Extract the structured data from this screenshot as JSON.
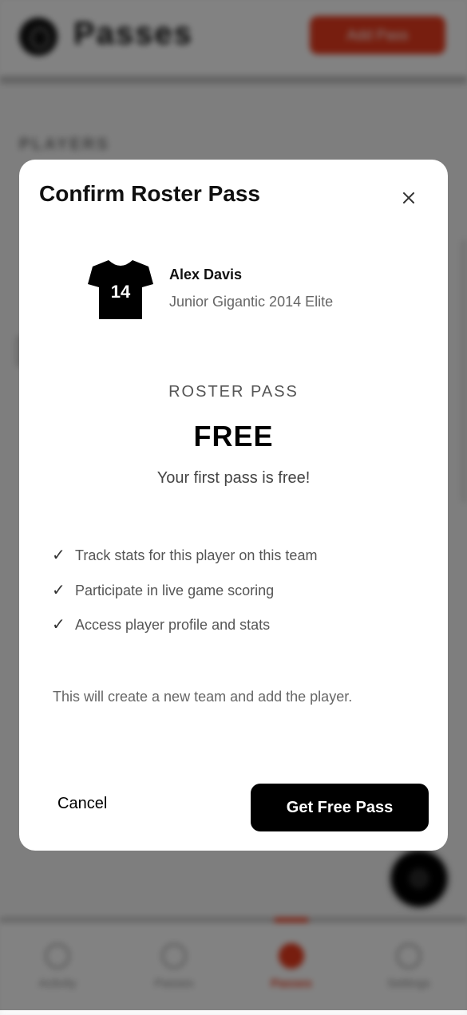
{
  "background": {
    "header_title": "Passes",
    "header_button": "Add Pass",
    "section_label": "PLAYERS",
    "tabs": [
      {
        "label": "Activity",
        "icon": "home-icon"
      },
      {
        "label": "Passes",
        "icon": "person-icon"
      },
      {
        "label": "Passes",
        "icon": "pass-icon"
      },
      {
        "label": "Settings",
        "icon": "settings-icon"
      }
    ]
  },
  "modal": {
    "title": "Confirm Roster Pass",
    "close_icon": "close-icon",
    "player": {
      "jersey_number": "14",
      "name": "Alex Davis",
      "team": "Junior Gigantic 2014 Elite"
    },
    "pass_label": "ROSTER PASS",
    "price": "FREE",
    "price_note": "Your first pass is free!",
    "features": [
      {
        "check": "✓",
        "text": "Track stats for this player on this team"
      },
      {
        "check": "✓",
        "text": "Participate in live game scoring"
      },
      {
        "check": "✓",
        "text": "Access player profile and stats"
      }
    ],
    "note": "This will create a new team and add the player.",
    "cancel_label": "Cancel",
    "confirm_label": "Get Free Pass"
  },
  "colors": {
    "accent": "#e53a1d",
    "primary_button": "#000000",
    "overlay": "rgba(0,0,0,0.48)"
  }
}
